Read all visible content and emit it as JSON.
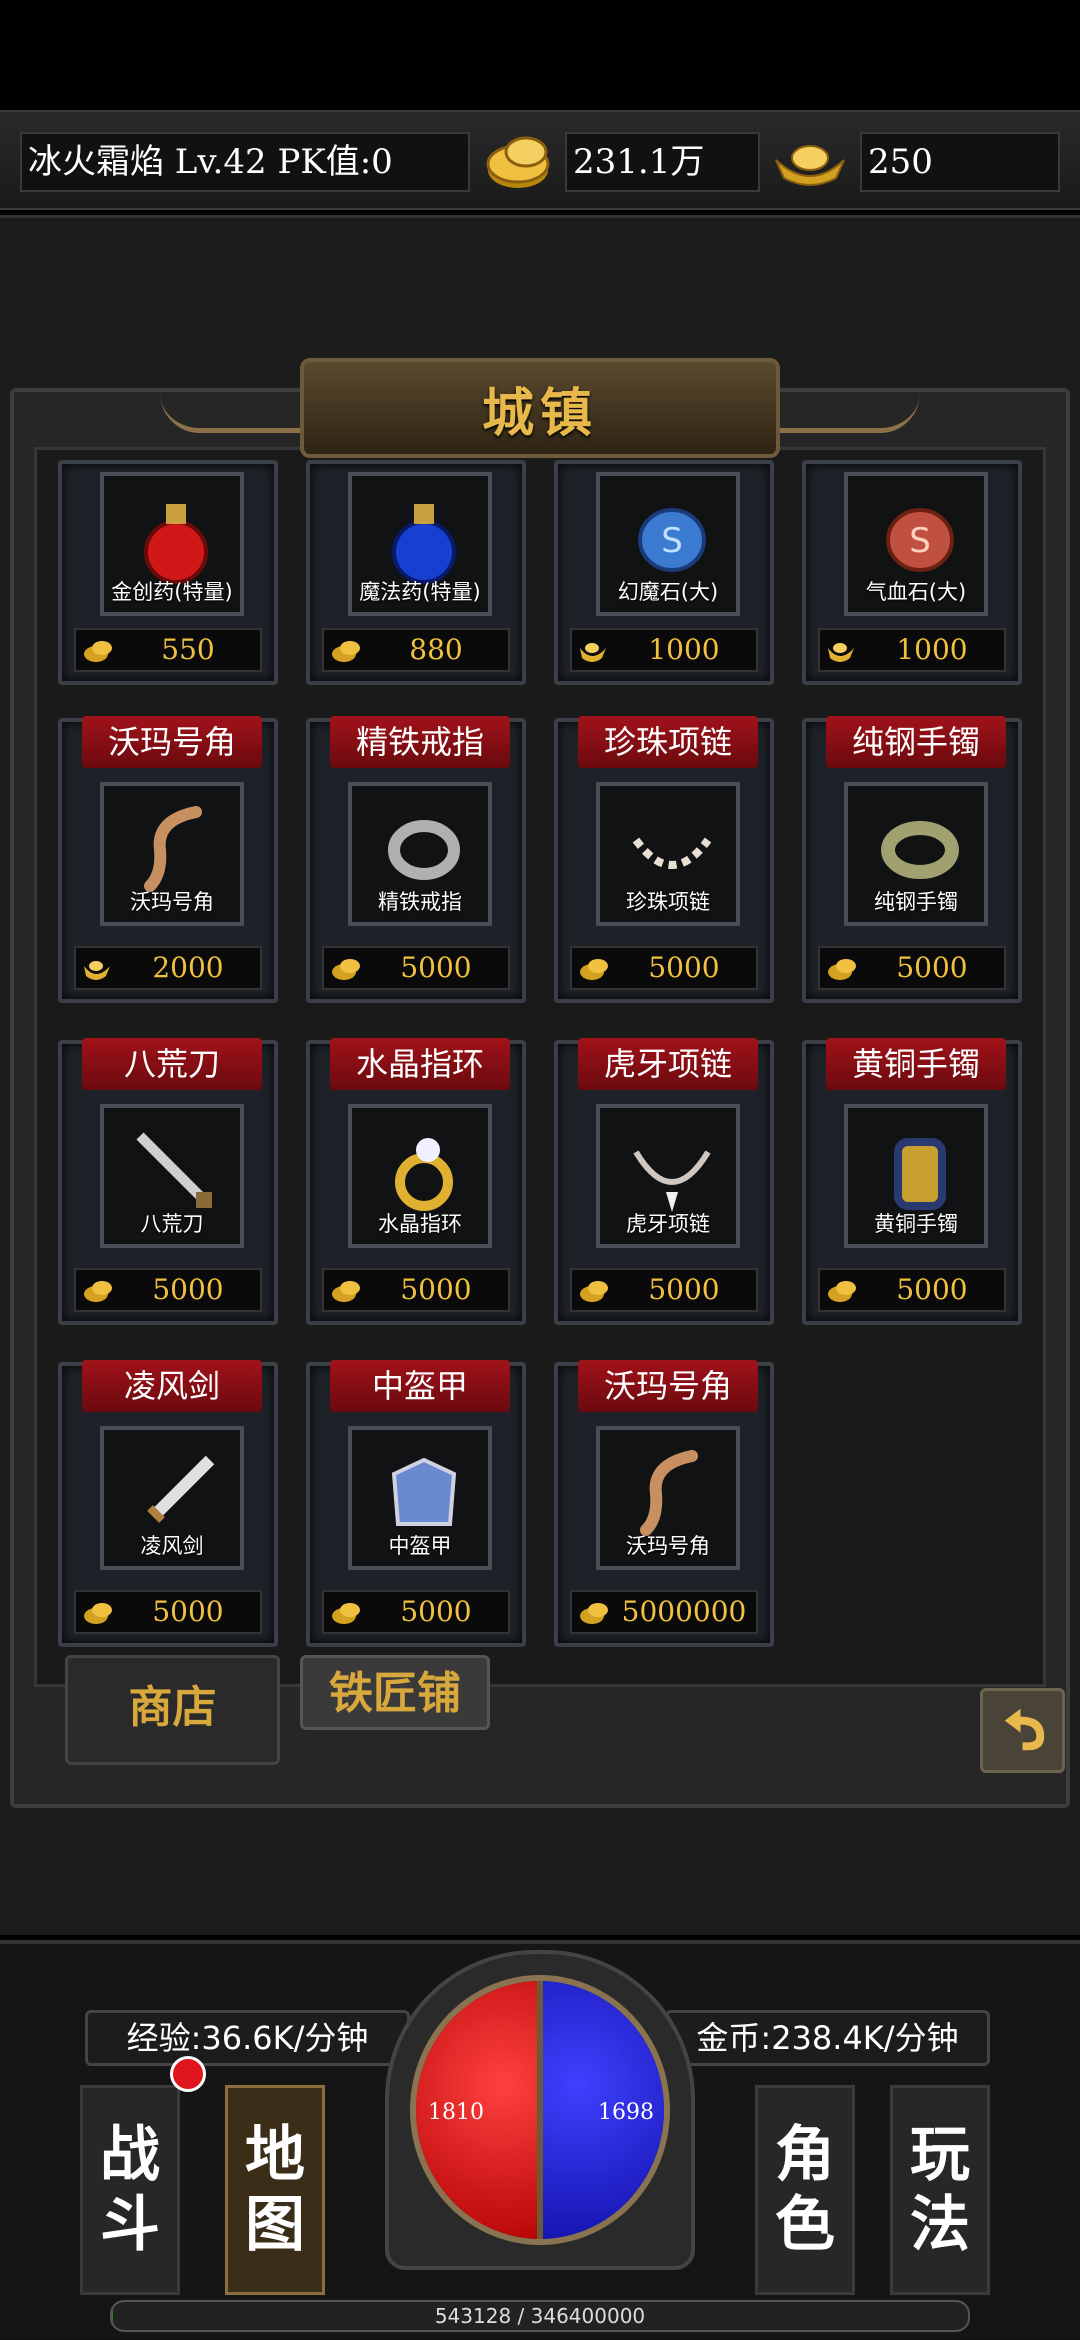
{
  "player": {
    "info": "冰火霜焰  Lv.42 PK值:0",
    "gold": "231.1万",
    "ingot": "250"
  },
  "panel": {
    "title": "城镇"
  },
  "shop_items": [
    {
      "label": "",
      "caption": "金创药(特量)",
      "price": "550",
      "icon": "red-potion-icon",
      "coin": "gold-coin-small-icon"
    },
    {
      "label": "",
      "caption": "魔法药(特量)",
      "price": "880",
      "icon": "blue-potion-icon",
      "coin": "gold-coin-small-icon"
    },
    {
      "label": "",
      "caption": "幻魔石(大)",
      "price": "1000",
      "icon": "blue-gem-icon",
      "coin": "ingot-small-icon"
    },
    {
      "label": "",
      "caption": "气血石(大)",
      "price": "1000",
      "icon": "red-gem-icon",
      "coin": "ingot-small-icon"
    },
    {
      "label": "沃玛号角",
      "caption": "沃玛号角",
      "price": "2000",
      "icon": "horn-icon",
      "coin": "ingot-small-icon"
    },
    {
      "label": "精铁戒指",
      "caption": "精铁戒指",
      "price": "5000",
      "icon": "iron-ring-icon",
      "coin": "gold-coin-small-icon"
    },
    {
      "label": "珍珠项链",
      "caption": "珍珠项链",
      "price": "5000",
      "icon": "pearl-necklace-icon",
      "coin": "gold-coin-small-icon"
    },
    {
      "label": "纯钢手镯",
      "caption": "纯钢手镯",
      "price": "5000",
      "icon": "steel-bracelet-icon",
      "coin": "gold-coin-small-icon"
    },
    {
      "label": "八荒刀",
      "caption": "八荒刀",
      "price": "5000",
      "icon": "blade-icon",
      "coin": "gold-coin-small-icon"
    },
    {
      "label": "水晶指环",
      "caption": "水晶指环",
      "price": "5000",
      "icon": "crystal-ring-icon",
      "coin": "gold-coin-small-icon"
    },
    {
      "label": "虎牙项链",
      "caption": "虎牙项链",
      "price": "5000",
      "icon": "fang-necklace-icon",
      "coin": "gold-coin-small-icon"
    },
    {
      "label": "黄铜手镯",
      "caption": "黄铜手镯",
      "price": "5000",
      "icon": "brass-bracelet-icon",
      "coin": "gold-coin-small-icon"
    },
    {
      "label": "凌风剑",
      "caption": "凌风剑",
      "price": "5000",
      "icon": "sword-icon",
      "coin": "gold-coin-small-icon"
    },
    {
      "label": "中盔甲",
      "caption": "中盔甲",
      "price": "5000",
      "icon": "armor-icon",
      "coin": "gold-coin-small-icon"
    },
    {
      "label": "沃玛号角",
      "caption": "沃玛号角",
      "price": "5000000",
      "icon": "horn-icon",
      "coin": "gold-coin-small-icon"
    }
  ],
  "tabs": {
    "shop": "商店",
    "blacksmith": "铁匠铺"
  },
  "rates": {
    "exp": "经验:36.6K/分钟",
    "gold": "金币:238.4K/分钟"
  },
  "nav": {
    "battle": "战斗",
    "map": "地图",
    "character": "角色",
    "gameplay": "玩法"
  },
  "orb": {
    "hp": "1810",
    "mp": "1698"
  },
  "exp_bar": {
    "text": "543128 / 346400000",
    "fraction": 0.0016
  },
  "colors": {
    "price_text": "#f0c040",
    "label_bg": "#a1121a",
    "title_gold": "#e8b94a"
  }
}
